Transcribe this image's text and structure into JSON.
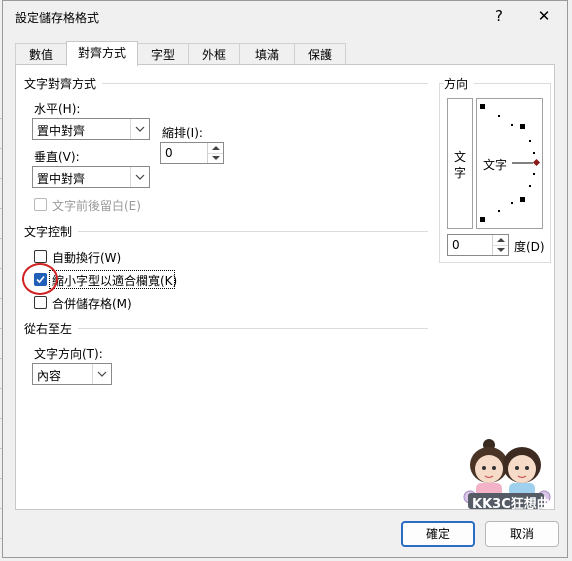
{
  "dialog": {
    "title": "設定儲存格格式",
    "help_label": "?",
    "close_label": "✕"
  },
  "tabs": [
    {
      "label": "數值"
    },
    {
      "label": "對齊方式"
    },
    {
      "label": "字型"
    },
    {
      "label": "外框"
    },
    {
      "label": "填滿"
    },
    {
      "label": "保護"
    }
  ],
  "text_alignment": {
    "title": "文字對齊方式",
    "horizontal_label": "水平(H):",
    "horizontal_value": "置中對齊",
    "indent_label": "縮排(I):",
    "indent_value": "0",
    "vertical_label": "垂直(V):",
    "vertical_value": "置中對齊",
    "justify_distributed_label": "文字前後留白(E)"
  },
  "orientation": {
    "title": "方向",
    "vertical_text_char1": "文",
    "vertical_text_char2": "字",
    "preview_text": "文字",
    "degrees_value": "0",
    "degrees_label": "度(D)"
  },
  "text_control": {
    "title": "文字控制",
    "wrap_label": "自動換行(W)",
    "wrap_checked": false,
    "shrink_label": "縮小字型以適合欄寬(K)",
    "shrink_checked": true,
    "merge_label": "合併儲存格(M)",
    "merge_checked": false
  },
  "rtl": {
    "title": "從右至左",
    "direction_label": "文字方向(T):",
    "direction_value": "內容"
  },
  "watermark": {
    "text": "KK3C狂想曲"
  },
  "footer": {
    "ok_label": "確定",
    "cancel_label": "取消"
  }
}
